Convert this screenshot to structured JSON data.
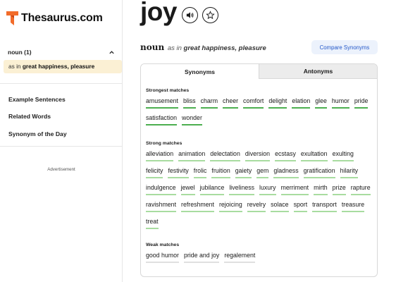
{
  "site": {
    "name": "Thesaurus.com"
  },
  "sidebar": {
    "sense_heading": "noun (1)",
    "sense_item": {
      "prefix": "as in",
      "phrase": "great happiness, pleasure"
    },
    "links": [
      "Example Sentences",
      "Related Words",
      "Synonym of the Day"
    ],
    "ad_label": "Advertisement"
  },
  "entry": {
    "word": "joy",
    "pos": "noun",
    "sense_prefix": "as in",
    "sense_phrase": "great happiness, pleasure",
    "compare_label": "Compare Synonyms"
  },
  "tabs": [
    {
      "label": "Synonyms",
      "active": true
    },
    {
      "label": "Antonyms",
      "active": false
    }
  ],
  "groups": {
    "strongest": {
      "title": "Strongest matches",
      "words": [
        "amusement",
        "bliss",
        "charm",
        "cheer",
        "comfort",
        "delight",
        "elation",
        "glee",
        "humor",
        "pride",
        "satisfaction",
        "wonder"
      ]
    },
    "strong": {
      "title": "Strong matches",
      "words": [
        "alleviation",
        "animation",
        "delectation",
        "diversion",
        "ecstasy",
        "exultation",
        "exulting",
        "felicity",
        "festivity",
        "frolic",
        "fruition",
        "gaiety",
        "gem",
        "gladness",
        "gratification",
        "hilarity",
        "indulgence",
        "jewel",
        "jubilance",
        "liveliness",
        "luxury",
        "merriment",
        "mirth",
        "prize",
        "rapture",
        "ravishment",
        "refreshment",
        "rejoicing",
        "revelry",
        "solace",
        "sport",
        "transport",
        "treasure",
        "treat"
      ]
    },
    "weak": {
      "title": "Weak matches",
      "words": [
        "good humor",
        "pride and joy",
        "regalement"
      ]
    }
  },
  "colors": {
    "brand": "#f26c2a",
    "strongest_underline": "#4caf50",
    "strong_underline": "#a8dca0",
    "weak_underline": "#e0e0e0",
    "highlight": "#fbf0d4",
    "link_blue": "#2458c9"
  },
  "icons": {
    "logo": "thesaurus-t-logo-icon",
    "audio": "speaker-icon",
    "favorite": "star-icon",
    "collapse": "chevron-up-icon"
  }
}
